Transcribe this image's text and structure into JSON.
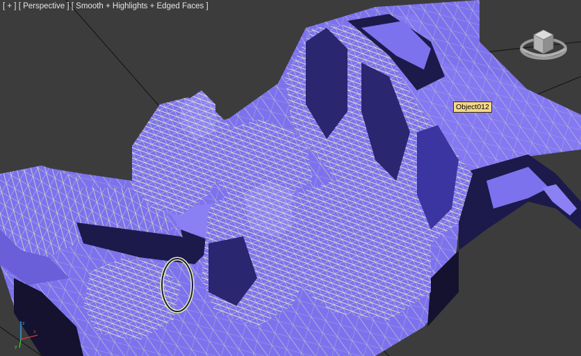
{
  "viewport": {
    "menu_plus": "[ + ]",
    "view_name": "[ Perspective ]",
    "shading_mode": "[ Smooth + Highlights + Edged Faces ]"
  },
  "tooltip": {
    "object_name": "Object012"
  },
  "icons": {
    "viewcube": "viewcube-icon",
    "axis": "axis-tripod-icon"
  },
  "colors": {
    "background": "#3c3c3c",
    "mesh_fill": "#7d72ee",
    "mesh_shadow": "#1c1a4a",
    "wire": "#ecf5b8",
    "tooltip_bg": "#f6d98a"
  }
}
